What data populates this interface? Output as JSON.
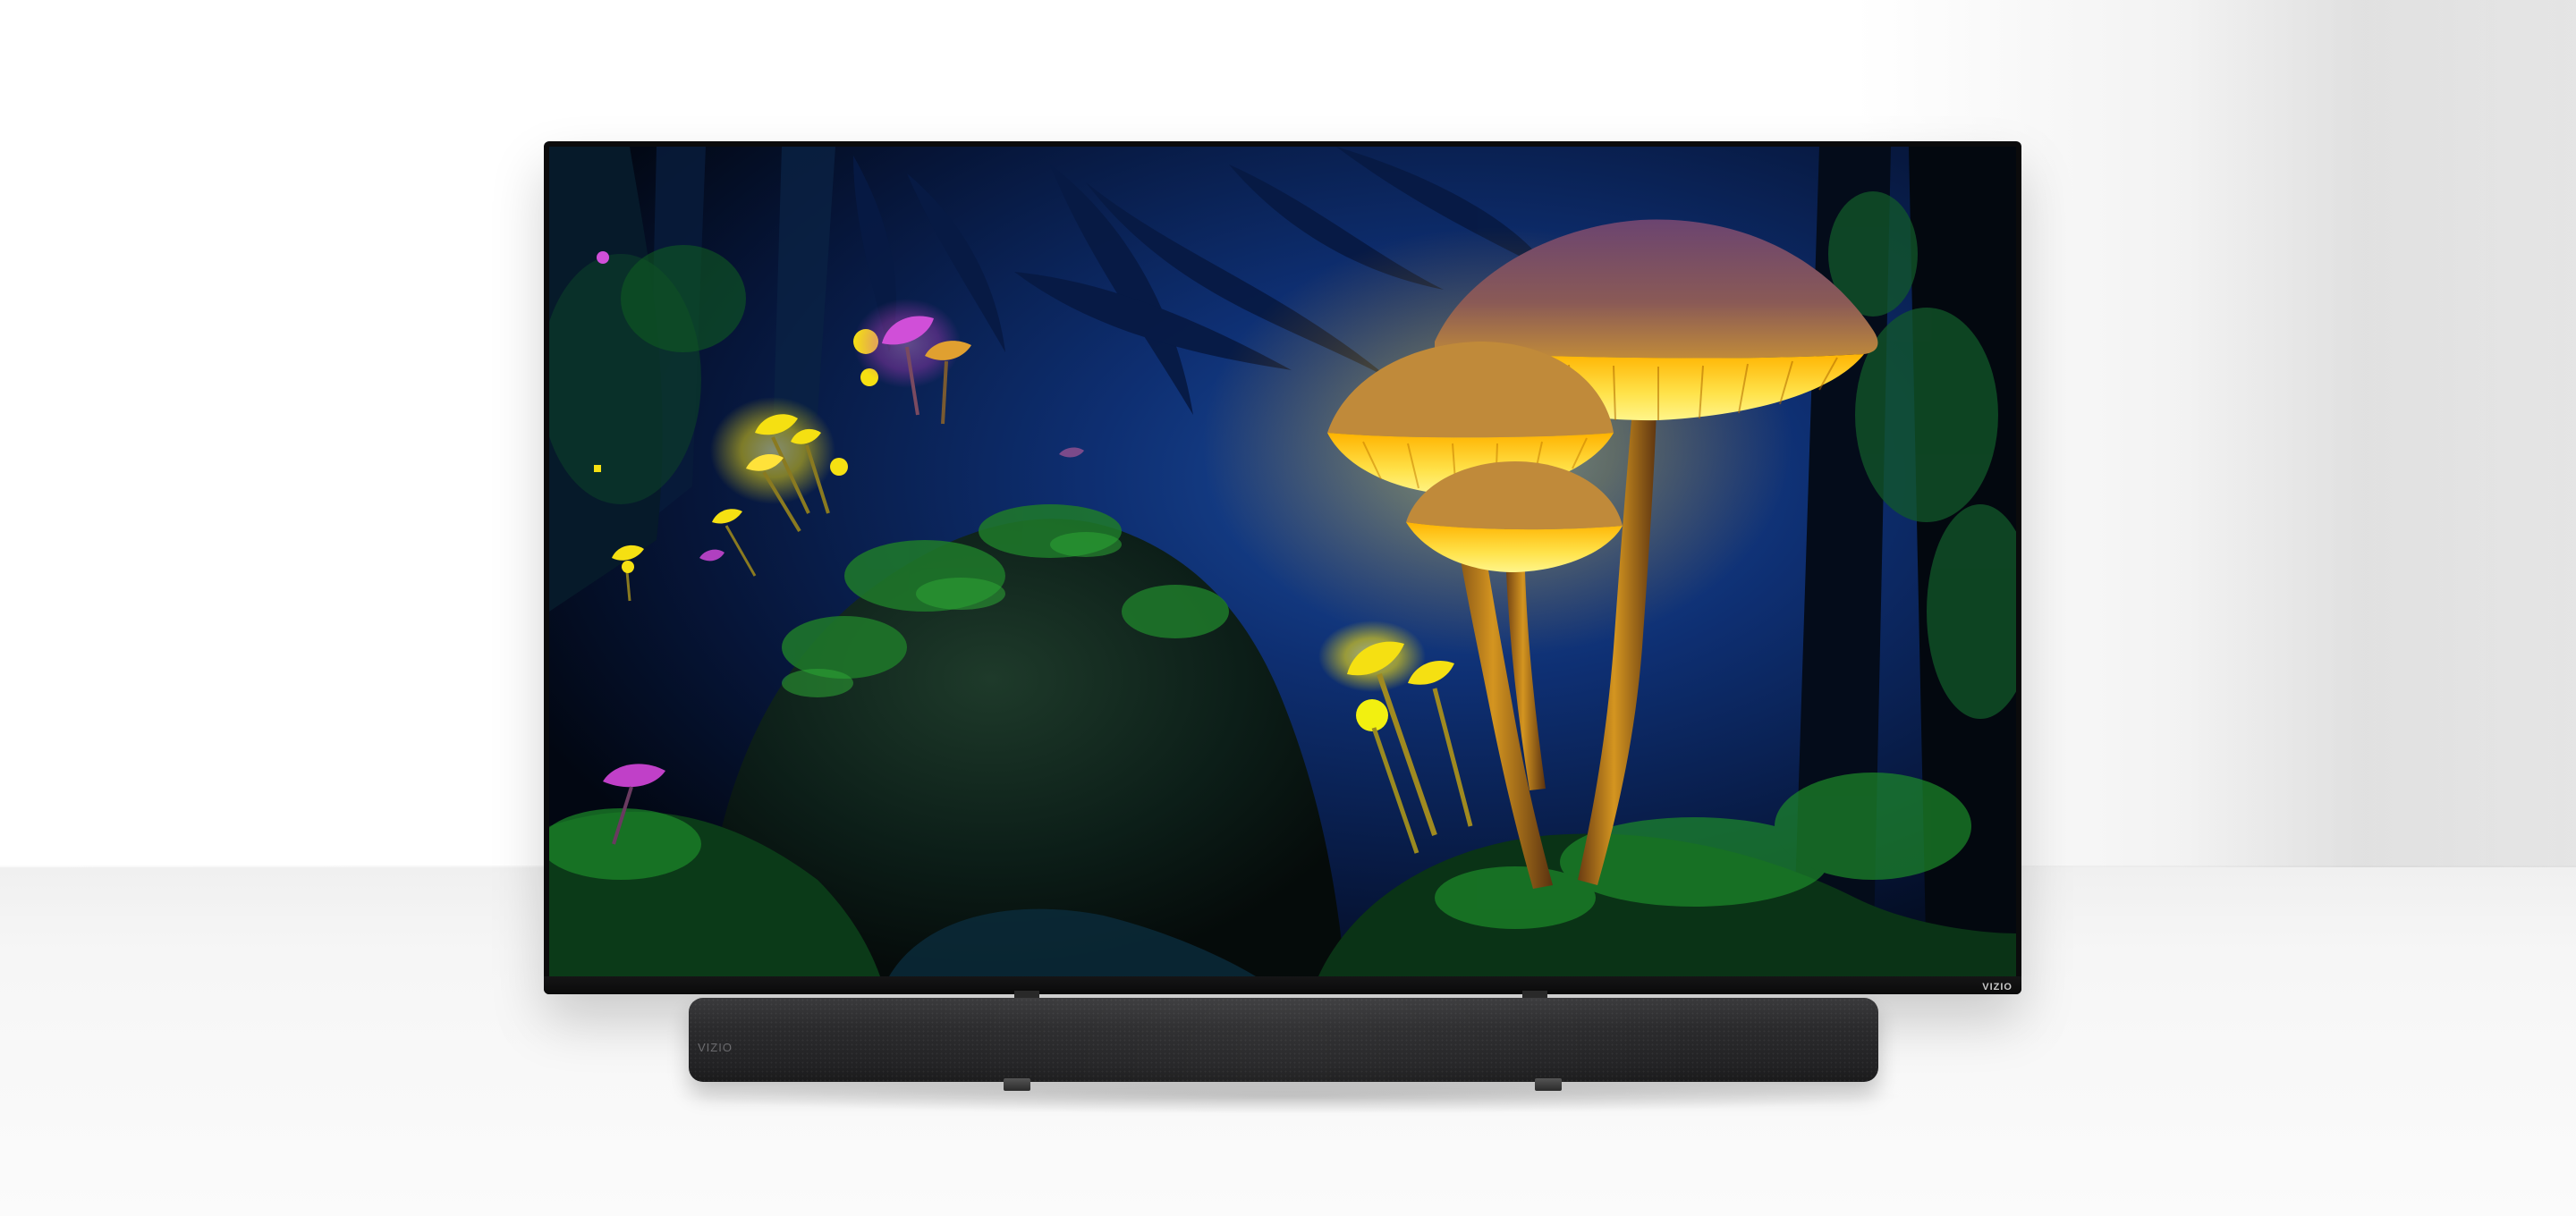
{
  "scene": {
    "subject": "television-with-soundbar",
    "tv": {
      "brand_label": "VIZIO",
      "bezel_color": "#0b0b0c"
    },
    "soundbar": {
      "brand_label": "VIZIO",
      "color": "#2b2b2d"
    },
    "screen_content": {
      "theme": "glowing-mushroom-forest",
      "glow_color": "#ffd21a",
      "accent_color": "#d04fd8",
      "sky_color": "#0b2a66",
      "foliage_color": "#0f5a22"
    }
  }
}
